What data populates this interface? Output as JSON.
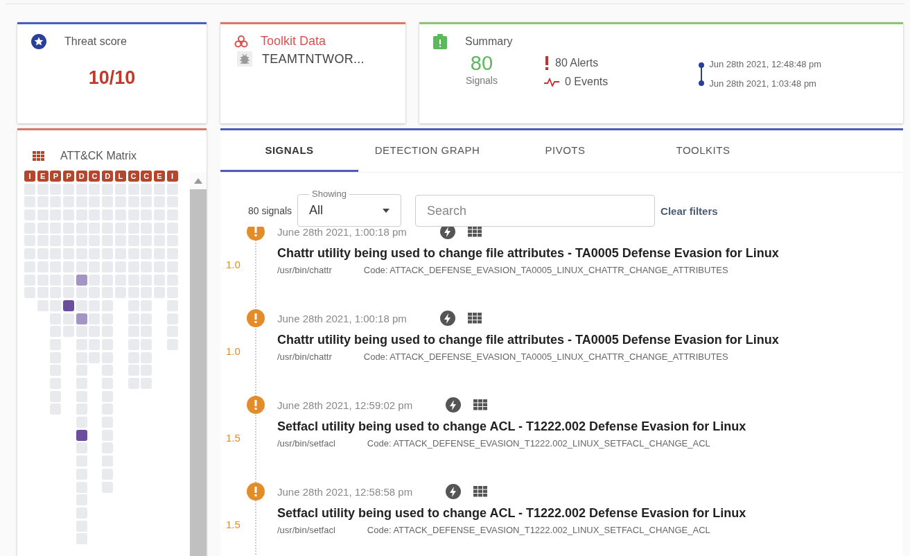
{
  "threat_card": {
    "title": "Threat score",
    "score": "10/10"
  },
  "toolkit_card": {
    "title": "Toolkit Data",
    "items": [
      "TEAMTNTWOR..."
    ]
  },
  "summary_card": {
    "title": "Summary",
    "signals_count": "80",
    "signals_label": "Signals",
    "alerts": "80 Alerts",
    "events": "0 Events",
    "start_time": "Jun 28th 2021, 12:48:48 pm",
    "end_time": "Jun 28th 2021, 1:03:48 pm"
  },
  "matrix": {
    "title": "ATT&CK Matrix",
    "columns": [
      {
        "label": "I",
        "cells": [
          {
            "color": "#e9eaee"
          },
          {
            "color": "#e9eaee"
          },
          {
            "color": "#e9eaee"
          },
          {
            "color": "#e9eaee"
          },
          {
            "color": "#e9eaee"
          },
          {
            "color": "#e9eaee"
          },
          {
            "color": "#e9eaee"
          },
          {
            "color": "#e9eaee"
          },
          {
            "color": "#e9eaee"
          }
        ]
      },
      {
        "label": "E",
        "cells": [
          {
            "color": "#e9eaee"
          },
          {
            "color": "#e9eaee"
          },
          {
            "color": "#e9eaee"
          },
          {
            "color": "#e9eaee"
          },
          {
            "color": "#e9eaee"
          },
          {
            "color": "#e9eaee"
          },
          {
            "color": "#e9eaee"
          },
          {
            "color": "#e9eaee"
          },
          {
            "color": "#e9eaee"
          },
          {
            "color": "#e9eaee"
          }
        ]
      },
      {
        "label": "P",
        "cells": [
          {
            "color": "#e9eaee"
          },
          {
            "color": "#e9eaee"
          },
          {
            "color": "#e9eaee"
          },
          {
            "color": "#e9eaee"
          },
          {
            "color": "#e9eaee"
          },
          {
            "color": "#e9eaee"
          },
          {
            "color": "#e9eaee"
          },
          {
            "color": "#e9eaee"
          },
          {
            "color": "#e9eaee"
          },
          {
            "color": "#e9eaee"
          },
          {
            "color": "#e9eaee"
          },
          {
            "color": "#e9eaee"
          },
          {
            "color": "#e9eaee"
          },
          {
            "color": "#e9eaee"
          },
          {
            "color": "#e9eaee"
          },
          {
            "color": "#e9eaee"
          },
          {
            "color": "#e9eaee"
          },
          {
            "color": "#e9eaee"
          }
        ]
      },
      {
        "label": "P",
        "cells": [
          {
            "color": "#e9eaee"
          },
          {
            "color": "#e9eaee"
          },
          {
            "color": "#e9eaee"
          },
          {
            "color": "#e9eaee"
          },
          {
            "color": "#e9eaee"
          },
          {
            "color": "#e9eaee"
          },
          {
            "color": "#e9eaee"
          },
          {
            "color": "#e9eaee"
          },
          {
            "color": "#e9eaee"
          },
          {
            "color": "#6b4f9c"
          },
          {
            "color": "#e9eaee"
          },
          {
            "color": "#e9eaee"
          }
        ]
      },
      {
        "label": "D",
        "cells": [
          {
            "color": "#e9eaee"
          },
          {
            "color": "#e9eaee"
          },
          {
            "color": "#e9eaee"
          },
          {
            "color": "#e9eaee"
          },
          {
            "color": "#e9eaee"
          },
          {
            "color": "#e9eaee"
          },
          {
            "color": "#e9eaee"
          },
          {
            "color": "#a396c4"
          },
          {
            "color": "#e9eaee"
          },
          {
            "color": "#e9eaee"
          },
          {
            "color": "#a396c4"
          },
          {
            "color": "#e9eaee"
          },
          {
            "color": "#e9eaee"
          },
          {
            "color": "#e9eaee"
          },
          {
            "color": "#e9eaee"
          },
          {
            "color": "#e9eaee"
          },
          {
            "color": "#e9eaee"
          },
          {
            "color": "#e9eaee"
          },
          {
            "color": "#e9eaee"
          },
          {
            "color": "#6b4f9c"
          },
          {
            "color": "#e9eaee"
          },
          {
            "color": "#e9eaee"
          },
          {
            "color": "#e9eaee"
          },
          {
            "color": "#e9eaee"
          },
          {
            "color": "#e9eaee"
          },
          {
            "color": "#e9eaee"
          },
          {
            "color": "#e9eaee"
          },
          {
            "color": "#e9eaee"
          }
        ]
      },
      {
        "label": "C",
        "cells": [
          {
            "color": "#e9eaee"
          },
          {
            "color": "#e9eaee"
          },
          {
            "color": "#e9eaee"
          },
          {
            "color": "#e9eaee"
          },
          {
            "color": "#e9eaee"
          },
          {
            "color": "#e9eaee"
          },
          {
            "color": "#e9eaee"
          },
          {
            "color": "#e9eaee"
          },
          {
            "color": "#e9eaee"
          },
          {
            "color": "#e9eaee"
          },
          {
            "color": "#e9eaee"
          },
          {
            "color": "#e9eaee"
          },
          {
            "color": "#e9eaee"
          },
          {
            "color": "#e9eaee"
          }
        ]
      },
      {
        "label": "D",
        "cells": [
          {
            "color": "#e9eaee"
          },
          {
            "color": "#e9eaee"
          },
          {
            "color": "#e9eaee"
          },
          {
            "color": "#e9eaee"
          },
          {
            "color": "#e9eaee"
          },
          {
            "color": "#e9eaee"
          },
          {
            "color": "#e9eaee"
          },
          {
            "color": "#e9eaee"
          },
          {
            "color": "#e9eaee"
          },
          {
            "color": "#e9eaee"
          },
          {
            "color": "#e9eaee"
          },
          {
            "color": "#e9eaee"
          },
          {
            "color": "#e9eaee"
          },
          {
            "color": "#e9eaee"
          },
          {
            "color": "#e9eaee"
          },
          {
            "color": "#e9eaee"
          },
          {
            "color": "#e9eaee"
          },
          {
            "color": "#e9eaee"
          },
          {
            "color": "#e9eaee"
          },
          {
            "color": "#e9eaee"
          },
          {
            "color": "#e9eaee"
          },
          {
            "color": "#e9eaee"
          },
          {
            "color": "#e9eaee"
          },
          {
            "color": "#e9eaee"
          }
        ]
      },
      {
        "label": "L",
        "cells": [
          {
            "color": "#e9eaee"
          },
          {
            "color": "#e9eaee"
          },
          {
            "color": "#e9eaee"
          },
          {
            "color": "#e9eaee"
          },
          {
            "color": "#e9eaee"
          },
          {
            "color": "#e9eaee"
          },
          {
            "color": "#e9eaee"
          },
          {
            "color": "#e9eaee"
          },
          {
            "color": "#e9eaee"
          }
        ]
      },
      {
        "label": "C",
        "cells": [
          {
            "color": "#e9eaee"
          },
          {
            "color": "#e9eaee"
          },
          {
            "color": "#e9eaee"
          },
          {
            "color": "#e9eaee"
          },
          {
            "color": "#e9eaee"
          },
          {
            "color": "#e9eaee"
          },
          {
            "color": "#e9eaee"
          },
          {
            "color": "#e9eaee"
          },
          {
            "color": "#e9eaee"
          },
          {
            "color": "#e9eaee"
          },
          {
            "color": "#e9eaee"
          },
          {
            "color": "#e9eaee"
          },
          {
            "color": "#e9eaee"
          },
          {
            "color": "#e9eaee"
          },
          {
            "color": "#e9eaee"
          },
          {
            "color": "#e9eaee"
          }
        ]
      },
      {
        "label": "C",
        "cells": [
          {
            "color": "#e9eaee"
          },
          {
            "color": "#e9eaee"
          },
          {
            "color": "#e9eaee"
          },
          {
            "color": "#e9eaee"
          },
          {
            "color": "#e9eaee"
          },
          {
            "color": "#e9eaee"
          },
          {
            "color": "#e9eaee"
          },
          {
            "color": "#e9eaee"
          },
          {
            "color": "#e9eaee"
          },
          {
            "color": "#e9eaee"
          },
          {
            "color": "#e9eaee"
          },
          {
            "color": "#e9eaee"
          },
          {
            "color": "#e9eaee"
          },
          {
            "color": "#e9eaee"
          },
          {
            "color": "#e9eaee"
          },
          {
            "color": "#e9eaee"
          }
        ]
      },
      {
        "label": "E",
        "cells": [
          {
            "color": "#e9eaee"
          },
          {
            "color": "#e9eaee"
          },
          {
            "color": "#e9eaee"
          },
          {
            "color": "#e9eaee"
          },
          {
            "color": "#e9eaee"
          },
          {
            "color": "#e9eaee"
          },
          {
            "color": "#e9eaee"
          },
          {
            "color": "#e9eaee"
          },
          {
            "color": "#e9eaee"
          }
        ]
      },
      {
        "label": "I",
        "cells": [
          {
            "color": "#e9eaee"
          },
          {
            "color": "#e9eaee"
          },
          {
            "color": "#e9eaee"
          },
          {
            "color": "#e9eaee"
          },
          {
            "color": "#e9eaee"
          },
          {
            "color": "#e9eaee"
          },
          {
            "color": "#e9eaee"
          },
          {
            "color": "#e9eaee"
          },
          {
            "color": "#e9eaee"
          },
          {
            "color": "#e9eaee"
          },
          {
            "color": "#e9eaee"
          },
          {
            "color": "#e9eaee"
          },
          {
            "color": "#e9eaee"
          }
        ]
      }
    ]
  },
  "tabs": [
    {
      "label": "SIGNALS",
      "selected": true
    },
    {
      "label": "DETECTION GRAPH",
      "selected": false
    },
    {
      "label": "PIVOTS",
      "selected": false
    },
    {
      "label": "TOOLKITS",
      "selected": false
    }
  ],
  "filters": {
    "count": "80 signals",
    "showing_label": "Showing",
    "showing_value": "All",
    "search_placeholder": "Search",
    "clear": "Clear filters"
  },
  "signals": [
    {
      "time": "June 28th 2021, 1:00:18 pm",
      "title": "Chattr utility being used to change file attributes - TA0005 Defense Evasion for Linux",
      "path": "/usr/bin/chattr",
      "code": "Code: ATTACK_DEFENSE_EVASION_TA0005_LINUX_CHATTR_CHANGE_ATTRIBUTES",
      "score": "1.0"
    },
    {
      "time": "June 28th 2021, 1:00:18 pm",
      "title": "Chattr utility being used to change file attributes - TA0005 Defense Evasion for Linux",
      "path": "/usr/bin/chattr",
      "code": "Code: ATTACK_DEFENSE_EVASION_TA0005_LINUX_CHATTR_CHANGE_ATTRIBUTES",
      "score": "1.0"
    },
    {
      "time": "June 28th 2021, 12:59:02 pm",
      "title": "Setfacl utility being used to change ACL - T1222.002 Defense Evasion for Linux",
      "path": "/usr/bin/setfacl",
      "code": "Code: ATTACK_DEFENSE_EVASION_T1222.002_LINUX_SETFACL_CHANGE_ACL",
      "score": "1.5"
    },
    {
      "time": "June 28th 2021, 12:58:58 pm",
      "title": "Setfacl utility being used to change ACL - T1222.002 Defense Evasion for Linux",
      "path": "/usr/bin/setfacl",
      "code": "Code: ATTACK_DEFENSE_EVASION_T1222.002_LINUX_SETFACL_CHANGE_ACL",
      "score": "1.5"
    }
  ]
}
